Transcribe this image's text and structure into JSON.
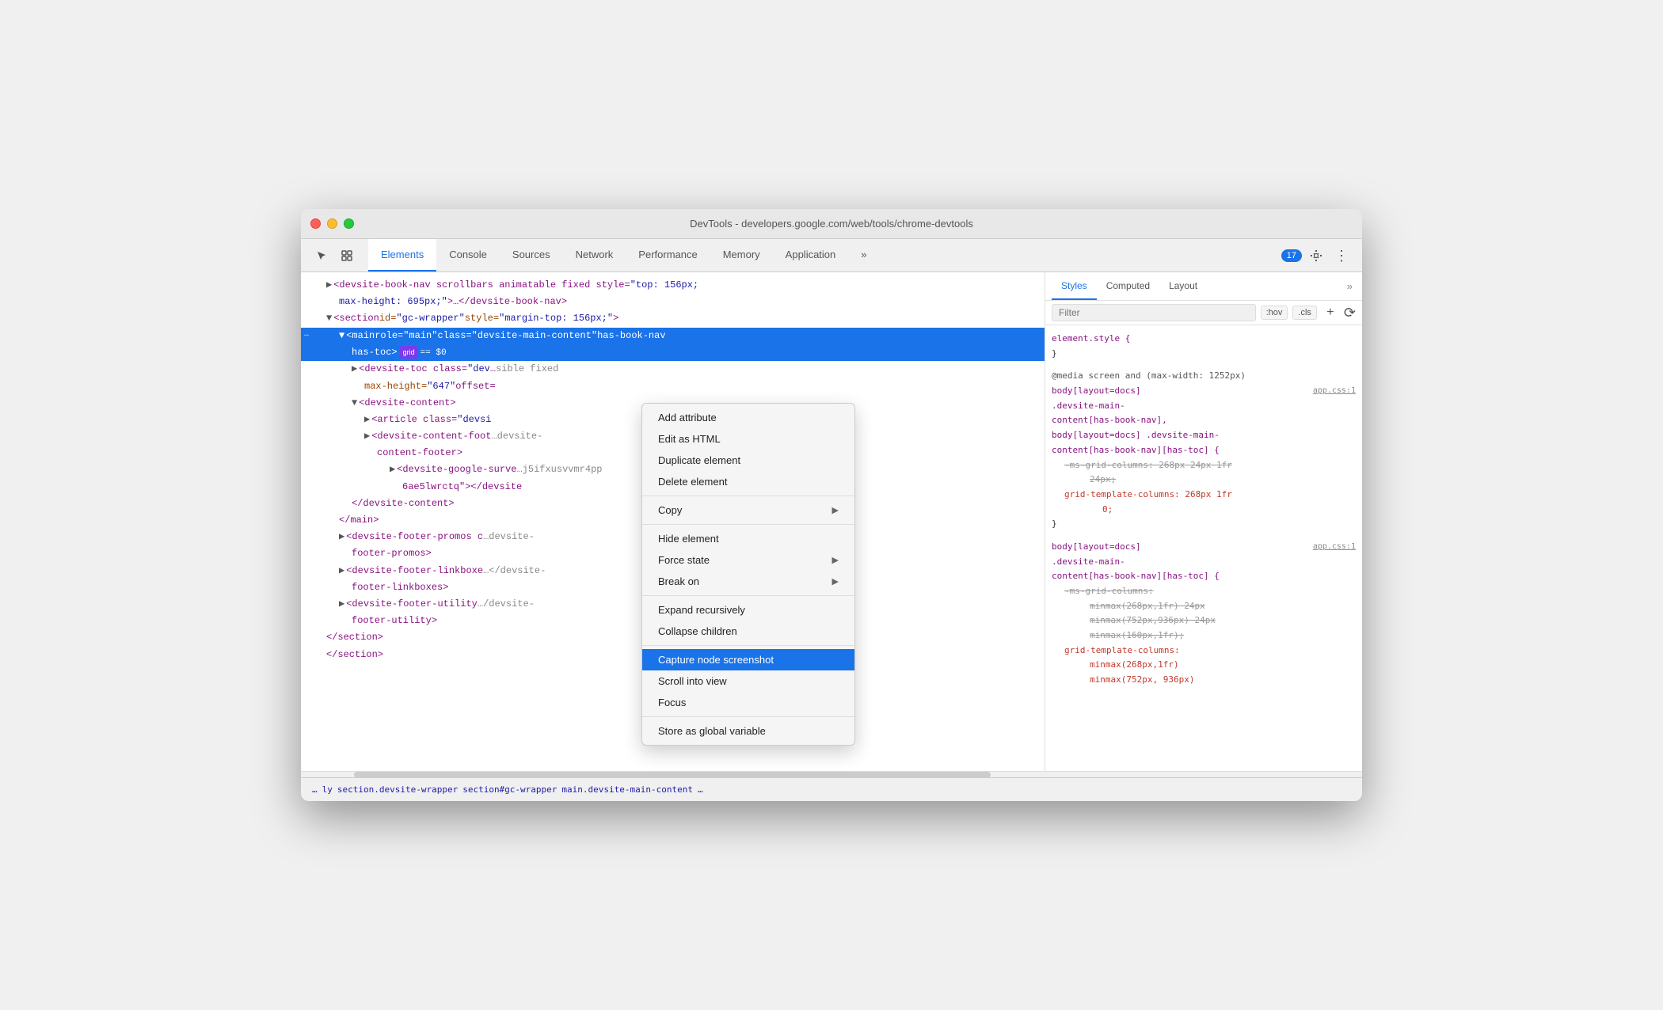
{
  "window": {
    "title": "DevTools - developers.google.com/web/tools/chrome-devtools"
  },
  "tabs": [
    {
      "id": "elements",
      "label": "Elements",
      "active": true
    },
    {
      "id": "console",
      "label": "Console",
      "active": false
    },
    {
      "id": "sources",
      "label": "Sources",
      "active": false
    },
    {
      "id": "network",
      "label": "Network",
      "active": false
    },
    {
      "id": "performance",
      "label": "Performance",
      "active": false
    },
    {
      "id": "memory",
      "label": "Memory",
      "active": false
    },
    {
      "id": "application",
      "label": "Application",
      "active": false
    }
  ],
  "badge": {
    "count": "17"
  },
  "dom": {
    "line1": "<devsite-book-nav scrollbars animatable fixed style=\"top: 156px;",
    "line2": "max-height: 695px;\">…</devsite-book-nav>",
    "line3": "<section id=\"gc-wrapper\" style=\"margin-top: 156px;\">",
    "line4_prefix": "<main role=\"main\" class=\"",
    "line4_class": "devsite-main-content",
    "line4_suffix": "\" has-book-nav",
    "line4_end": "has-toc>",
    "line4_badge": "grid",
    "line4_equals": "== $0",
    "line5": "<devsite-toc class=\"dev",
    "line5_suffix": "sible fixed",
    "line5_cont": "max-height=\"647\" offset=",
    "line6": "<devsite-content>",
    "line7": "<article class=\"devsi",
    "line8": "<devsite-content-foot",
    "line8_suffix": "devsite-",
    "line9": "content-footer>",
    "line10": "<devsite-google-surve",
    "line10_suffix": "j5ifxusvvmr4pp",
    "line11": "6ae5lwrctq\"></devsite",
    "line12": "</devsite-content>",
    "line13": "</main>",
    "line14": "<devsite-footer-promos c",
    "line14_suffix": "devsite-",
    "line15": "footer-promos>",
    "line16": "<devsite-footer-linkboxe",
    "line16_suffix": "</devsite-",
    "line17": "footer-linkboxes>",
    "line18": "<devsite-footer-utility",
    "line18_suffix": "/devsite-",
    "line19": "footer-utility>",
    "line20": "</section>",
    "line21": "</section>"
  },
  "context_menu": {
    "items": [
      {
        "id": "add-attribute",
        "label": "Add attribute",
        "has_submenu": false
      },
      {
        "id": "edit-html",
        "label": "Edit as HTML",
        "has_submenu": false
      },
      {
        "id": "duplicate",
        "label": "Duplicate element",
        "has_submenu": false
      },
      {
        "id": "delete",
        "label": "Delete element",
        "has_submenu": false
      },
      {
        "separator1": true
      },
      {
        "id": "copy",
        "label": "Copy",
        "has_submenu": true
      },
      {
        "separator2": true
      },
      {
        "id": "hide",
        "label": "Hide element",
        "has_submenu": false
      },
      {
        "id": "force-state",
        "label": "Force state",
        "has_submenu": true
      },
      {
        "id": "break-on",
        "label": "Break on",
        "has_submenu": true
      },
      {
        "separator3": true
      },
      {
        "id": "expand",
        "label": "Expand recursively",
        "has_submenu": false
      },
      {
        "id": "collapse",
        "label": "Collapse children",
        "has_submenu": false
      },
      {
        "separator4": true
      },
      {
        "id": "capture-screenshot",
        "label": "Capture node screenshot",
        "has_submenu": false,
        "highlighted": true
      },
      {
        "id": "scroll-into-view",
        "label": "Scroll into view",
        "has_submenu": false
      },
      {
        "id": "focus",
        "label": "Focus",
        "has_submenu": false
      },
      {
        "separator5": true
      },
      {
        "id": "store-global",
        "label": "Store as global variable",
        "has_submenu": false
      }
    ]
  },
  "styles_panel": {
    "tabs": [
      {
        "id": "styles",
        "label": "Styles",
        "active": true
      },
      {
        "id": "computed",
        "label": "Computed",
        "active": false
      },
      {
        "id": "layout",
        "label": "Layout",
        "active": false
      }
    ],
    "filter_placeholder": "Filter",
    "hov_label": ":hov",
    "cls_label": ".cls",
    "css_rules": [
      {
        "selector": "element.style {",
        "close": "}",
        "props": []
      },
      {
        "media": "@media screen and (max-width: 1252px)",
        "selector": "body[layout=docs]",
        "selector2": ".devsite-main-content[has-book-nav],",
        "selector3": "body[layout=docs] .devsite-main-content[has-book-nav][has-toc] {",
        "source": "app.css:1",
        "props": [
          {
            "name": "-ms-grid-columns:",
            "value": "268px 24px 1fr 24px;",
            "strikethrough": true
          },
          {
            "name": "grid-template-columns:",
            "value": "268px 1fr 0;",
            "red": true
          }
        ],
        "close": "}"
      },
      {
        "selector": "body[layout=docs]",
        "selector2": ".devsite-main-content[has-book-nav][has-toc] {",
        "source": "app.css:1",
        "props": [
          {
            "name": "-ms-grid-columns:",
            "value": "minmax(268px,1fr) 24px minmax(752px,936px) 24px minmax(160px,1fr);",
            "strikethrough": true
          },
          {
            "name": "grid-template-columns:",
            "value": "minmax(268px,1fr)",
            "red": true,
            "continued": true
          },
          {
            "name": "",
            "value": "minmax(752px, 936px)",
            "red": true,
            "continued": true
          }
        ]
      }
    ]
  },
  "breadcrumb": {
    "items": [
      {
        "label": "…"
      },
      {
        "label": "ly"
      },
      {
        "label": "section.devsite-wrapper"
      },
      {
        "label": "section#gc-wrapper"
      },
      {
        "label": "main.devsite-main-content"
      },
      {
        "label": "…"
      }
    ]
  }
}
